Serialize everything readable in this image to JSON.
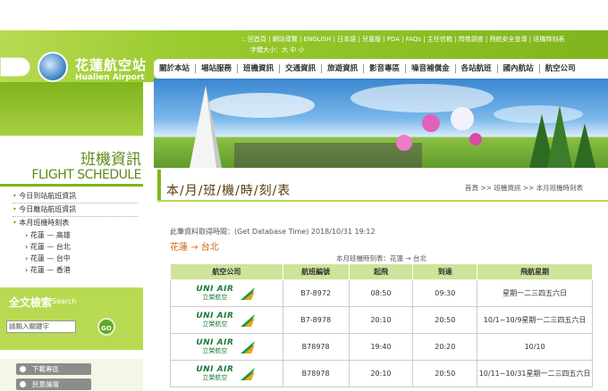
{
  "header": {
    "util_links": [
      "回首頁",
      "網站導覽",
      "ENGLISH",
      "日本語",
      "兒童版",
      "PDA",
      "FAQs",
      "主任信箱",
      "問卷調查",
      "飛航安全宣導",
      "班機時刻表"
    ],
    "font_size_label": "字體大小：大 中 小",
    "logo_cn": "花蓮航空站",
    "logo_en": "Hualien Airport"
  },
  "nav": {
    "items": [
      "關於本站",
      "場站服務",
      "班機資訊",
      "交通資訊",
      "旅遊資訊",
      "影音專區",
      "噪音補償金",
      "各站航班",
      "國內航站",
      "航空公司"
    ]
  },
  "sidebar": {
    "section_cn": "班機資訊",
    "section_en": "FLIGHT SCHEDULE",
    "menu": [
      {
        "label": "今日到站航班資訊"
      },
      {
        "label": "今日離站航班資訊"
      },
      {
        "label": "本月班機時刻表"
      }
    ],
    "submenu": [
      "花蓮 — 高雄",
      "花蓮 — 台北",
      "花蓮 — 台中",
      "花蓮 — 香港"
    ],
    "search": {
      "title": "全文檢索",
      "subtitle": "Search",
      "placeholder": "請輸入關鍵字",
      "go_label": "GO"
    },
    "downloads": [
      "下載專區",
      "民意論壇"
    ]
  },
  "main": {
    "page_title": "本/月/班/機/時/刻/表",
    "breadcrumb": "首頁 >> 班機資訊 >> 本月班機時刻表",
    "db_time": "此筆資料取得時間：(Get Database Time) 2018/10/31 19:12",
    "route": "花蓮 → 台北",
    "table_caption": "本月班機時刻表：花蓮 → 台北",
    "columns": [
      "航空公司",
      "航班編號",
      "起飛",
      "到達",
      "飛航星期"
    ],
    "airline": {
      "en": "UNI AIR",
      "cn": "立榮航空"
    },
    "rows": [
      {
        "flight": "B7-8972",
        "depart": "08:50",
        "arrive": "09:30",
        "days": "星期一二三四五六日"
      },
      {
        "flight": "B7-8978",
        "depart": "20:10",
        "arrive": "20:50",
        "days": "10/1~10/9星期一二三四五六日"
      },
      {
        "flight": "B78978",
        "depart": "19:40",
        "arrive": "20:20",
        "days": "10/10"
      },
      {
        "flight": "B78978",
        "depart": "20:10",
        "arrive": "20:50",
        "days": "10/11~10/31星期一二三四五六日"
      }
    ]
  }
}
